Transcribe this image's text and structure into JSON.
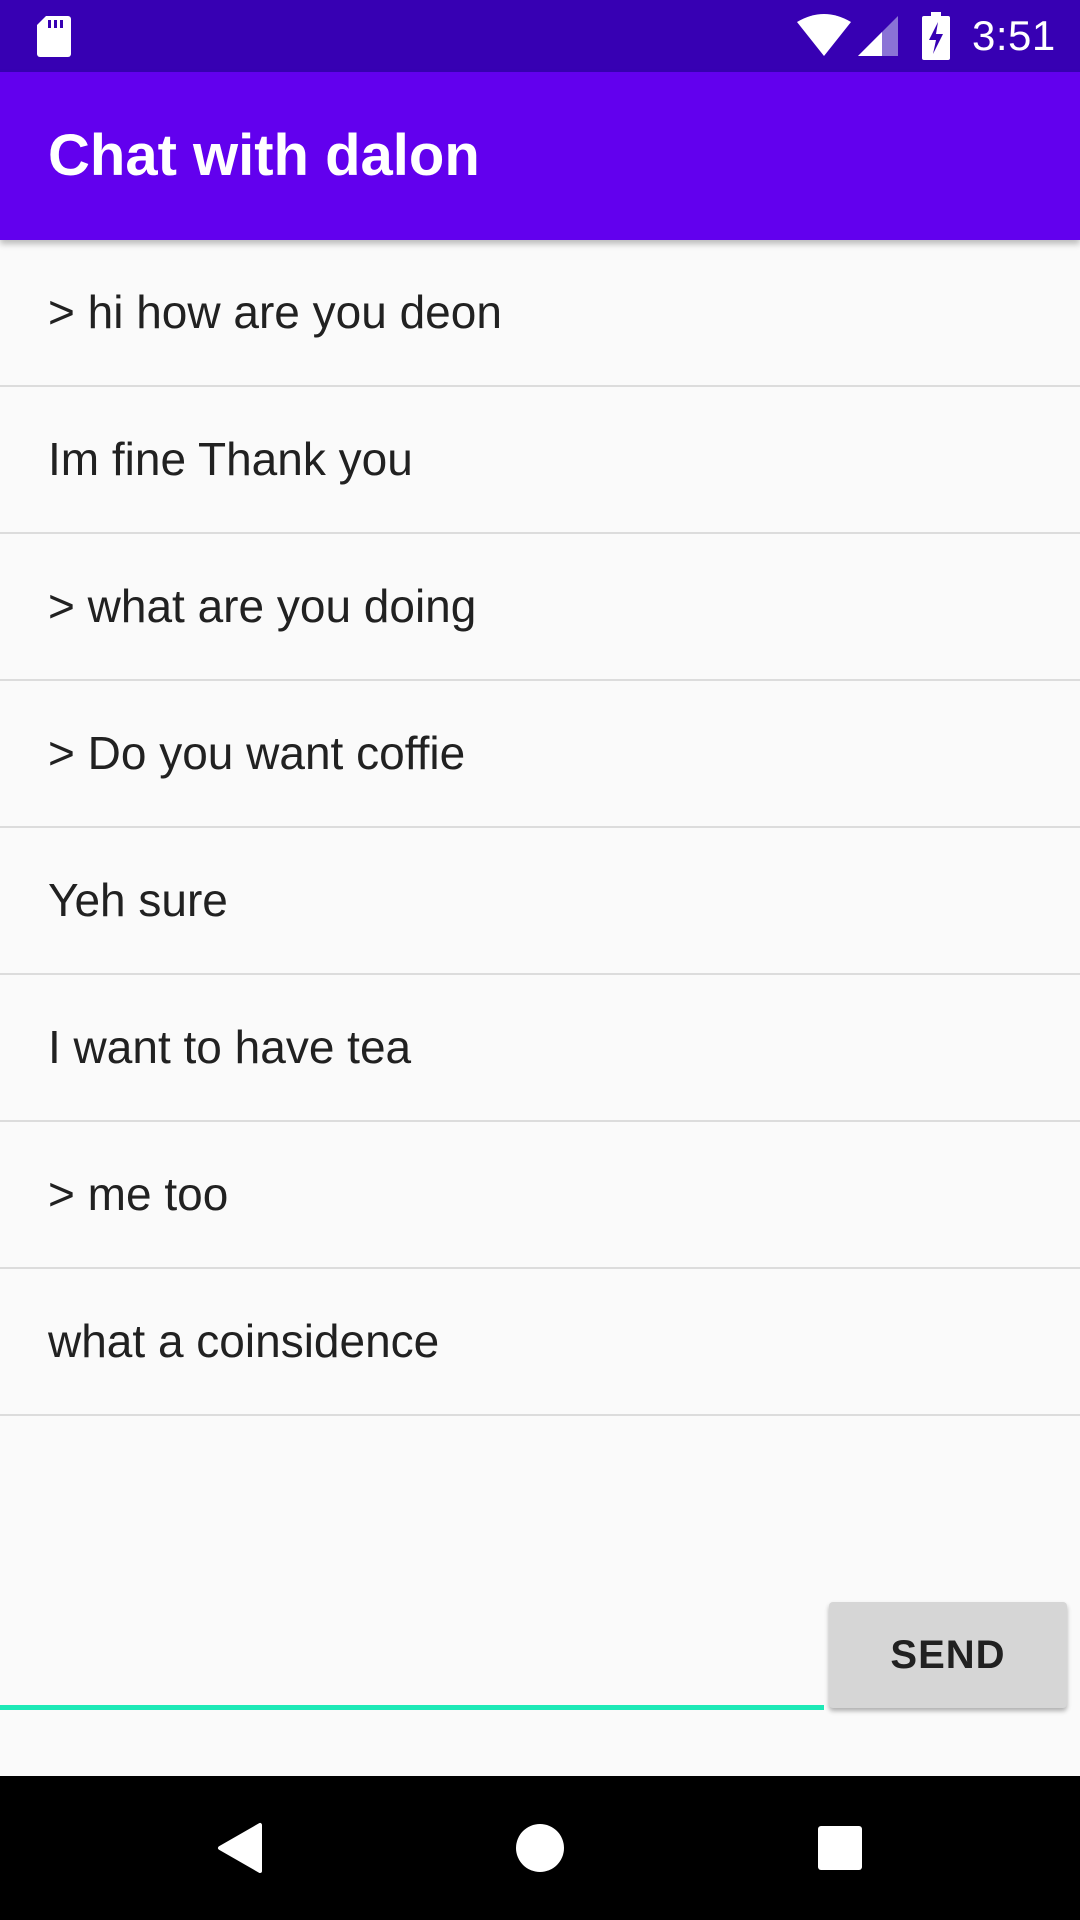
{
  "status_bar": {
    "time": "3:51",
    "icons": [
      "sd-card-icon",
      "wifi-icon",
      "cell-signal-icon",
      "battery-charging-icon"
    ]
  },
  "app_bar": {
    "title": "Chat with dalon",
    "color": "#6200ee"
  },
  "messages": [
    {
      "text": "> hi how are you deon"
    },
    {
      "text": "Im fine Thank you"
    },
    {
      "text": "> what are you doing"
    },
    {
      "text": "> Do you want coffie"
    },
    {
      "text": "Yeh sure"
    },
    {
      "text": "I want to have tea"
    },
    {
      "text": "> me too"
    },
    {
      "text": "what a coinsidence"
    }
  ],
  "composer": {
    "input_value": "",
    "send_label": "SEND",
    "accent_color": "#1de9b6"
  },
  "nav_bar": {
    "buttons": [
      "back-icon",
      "home-icon",
      "recents-icon"
    ]
  }
}
